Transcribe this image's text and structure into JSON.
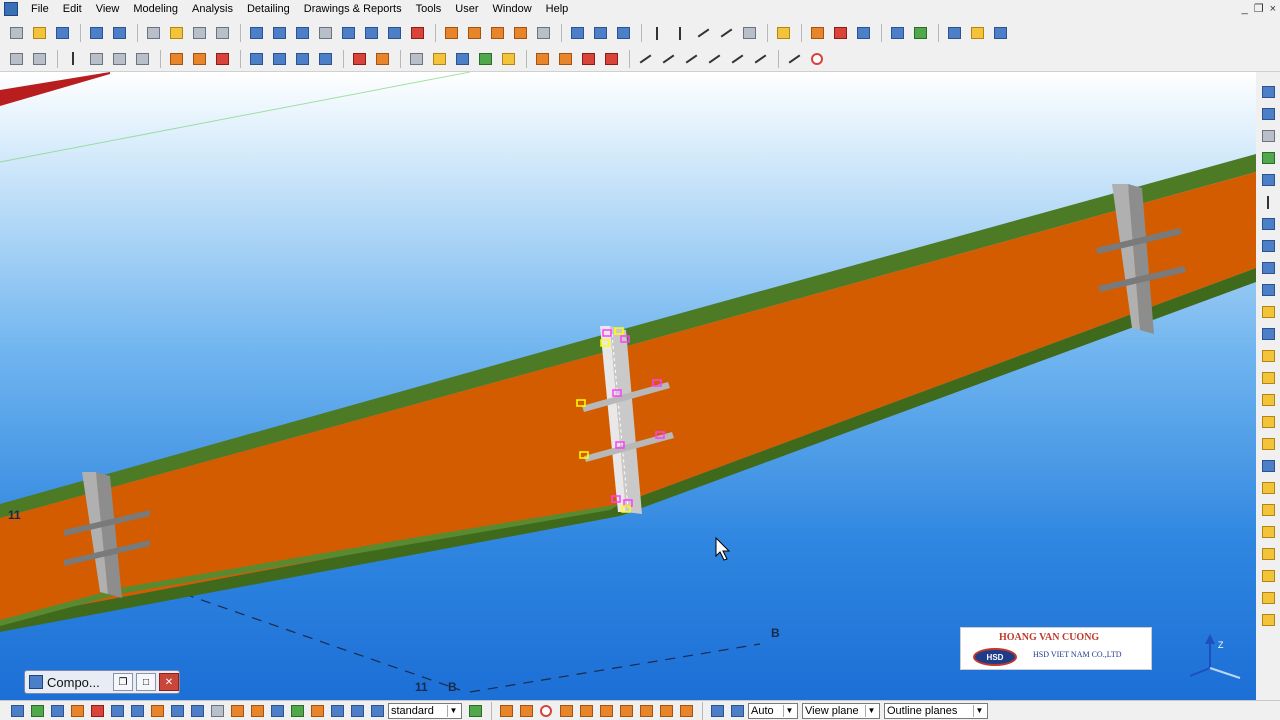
{
  "menu": {
    "items": [
      "File",
      "Edit",
      "View",
      "Modeling",
      "Analysis",
      "Detailing",
      "Drawings & Reports",
      "Tools",
      "User",
      "Window",
      "Help"
    ],
    "window_controls": [
      "_",
      "❐",
      "×"
    ]
  },
  "toolbar1": {
    "buttons": [
      "new-file",
      "open-folder",
      "save",
      "undo",
      "redo",
      "copy",
      "paste",
      "print",
      "filter",
      "window-select",
      "zoom-window",
      "zoom-original",
      "cut",
      "select-all",
      "tile",
      "layers",
      "clash",
      "part-yellow",
      "part-orange",
      "weld",
      "bolt",
      "help-a",
      "help-b",
      "help-c",
      "grid-a",
      "grid-b",
      "grid-c",
      "grid-d",
      "grid-e",
      "pick",
      "copy-special",
      "delete",
      "properties",
      "render",
      "web",
      "arrows",
      "folder-open",
      "list"
    ]
  },
  "toolbar2": {
    "buttons": [
      "plate-lock",
      "plate-unlock",
      "column",
      "beam",
      "slab",
      "panel",
      "rebar-u",
      "rebar-shape",
      "mesh",
      "bolt-vertical",
      "stiffener",
      "pad-footing",
      "weld-marker",
      "binoculars",
      "yellow-ball",
      "profile-t",
      "profile-arrow",
      "brick",
      "ref-a",
      "ref-b",
      "ref-c",
      "ref-d",
      "line-a",
      "line-b",
      "line-c",
      "line-d",
      "line-e",
      "line-f",
      "measure",
      "circle-target"
    ]
  },
  "right_toolbar": {
    "buttons": [
      "snap-end",
      "snap-ref",
      "binoculars",
      "arrow-left",
      "arrow-right",
      "snap-a",
      "snap-b",
      "snap-c",
      "snap-d",
      "snap-e",
      "snap-f",
      "snap-g",
      "snap-h",
      "snap-i",
      "snap-j",
      "snap-k",
      "snap-l",
      "snap-m",
      "snap-n",
      "snap-o",
      "snap-p",
      "snap-q",
      "snap-r",
      "snap-s",
      "snap-t"
    ]
  },
  "component_panel": {
    "title": "Compo..."
  },
  "bottom": {
    "standard_select": "standard",
    "auto_select": "Auto",
    "view_plane_select": "View plane",
    "outline_select": "Outline planes"
  },
  "grid_labels": {
    "label_11_left": "11",
    "label_11_bottom": "11",
    "label_b_bottom": "B",
    "label_b_right": "B"
  },
  "logo": {
    "name": "HOANG VAN CUONG",
    "badge": "HSD",
    "company": "HSD VIET NAM CO.,LTD"
  },
  "colors": {
    "beam_web": "#d45c00",
    "beam_flange": "#4d7a25",
    "stiffener": "#9a9a9a",
    "selected_marker": "#ff3cff",
    "handle_marker": "#ffff00",
    "sky_top": "#ffffff",
    "sky_bottom": "#1c6fd6"
  }
}
